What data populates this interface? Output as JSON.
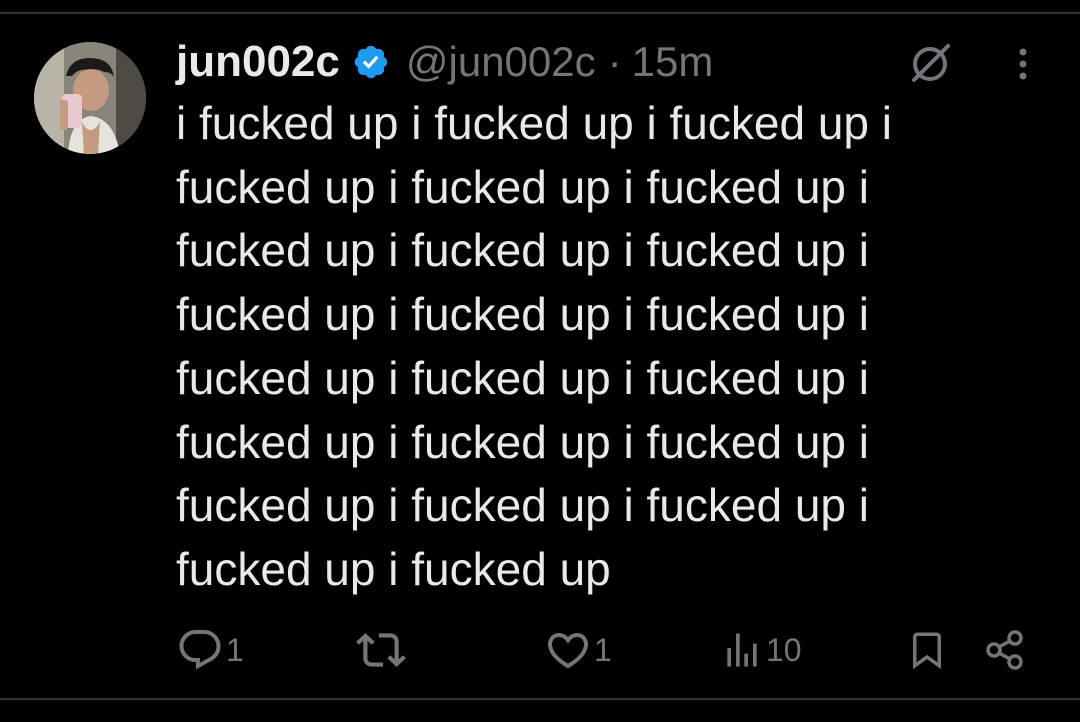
{
  "tweet": {
    "display_name": "jun002c",
    "handle": "@jun002c",
    "separator": "·",
    "timestamp": "15m",
    "text_lines": [
      "i fucked up i fucked up i fucked up i",
      "fucked up i fucked up i fucked up i",
      "fucked up i fucked up i fucked up i",
      "fucked up i fucked up i fucked up i",
      "fucked up i fucked up i fucked up i",
      "fucked up i fucked up i fucked up i",
      "fucked up i fucked up i fucked up i",
      "fucked up i fucked up"
    ]
  },
  "actions": {
    "reply_count": "1",
    "retweet_count": "",
    "like_count": "1",
    "views_count": "10"
  },
  "icons": {
    "verified": "verified-badge-icon",
    "grok": "grok-icon",
    "more": "more-options-icon",
    "reply": "reply-icon",
    "retweet": "retweet-icon",
    "like": "heart-icon",
    "views": "views-icon",
    "bookmark": "bookmark-icon",
    "share": "share-icon"
  },
  "colors": {
    "background": "#000000",
    "text_primary": "#e7e9ea",
    "text_secondary": "#71767b",
    "verified_blue": "#1d9bf0",
    "divider": "#2f3336"
  }
}
